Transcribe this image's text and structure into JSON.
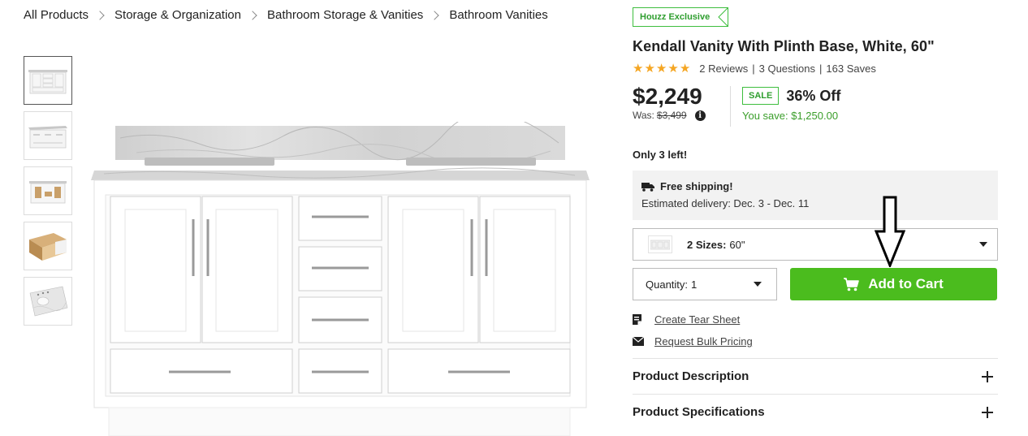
{
  "breadcrumb": [
    "All Products",
    "Storage & Organization",
    "Bathroom Storage & Vanities",
    "Bathroom Vanities"
  ],
  "product": {
    "badge": "Houzz Exclusive",
    "title": "Kendall Vanity With Plinth Base, White, 60\"",
    "rating": 5,
    "reviews": "2 Reviews",
    "questions": "3 Questions",
    "saves": "163 Saves",
    "price": "$2,249",
    "was_label": "Was:",
    "was_price": "$3,499",
    "sale_label": "SALE",
    "discount": "36% Off",
    "you_save": "You save: $1,250.00",
    "stock": "Only 3 left!"
  },
  "shipping": {
    "title": "Free shipping!",
    "delivery": "Estimated delivery: Dec. 3 - Dec. 11"
  },
  "size_select": {
    "label": "2 Sizes:",
    "value": "60\""
  },
  "quantity": {
    "label": "Quantity:",
    "value": "1"
  },
  "add_to_cart": "Add to Cart",
  "links": {
    "tear_sheet": "Create Tear Sheet",
    "bulk_pricing": "Request Bulk Pricing"
  },
  "accordion": [
    "Product Description",
    "Product Specifications"
  ],
  "colors": {
    "accent_green": "#4bbc1e",
    "star": "#f5a623",
    "save_green": "#3a9e2a"
  },
  "icons": [
    "chevron-right-icon",
    "star-icon",
    "info-icon",
    "truck-icon",
    "chevron-down-icon",
    "cart-icon",
    "tear-sheet-icon",
    "envelope-icon",
    "plus-icon",
    "down-arrow-icon"
  ]
}
